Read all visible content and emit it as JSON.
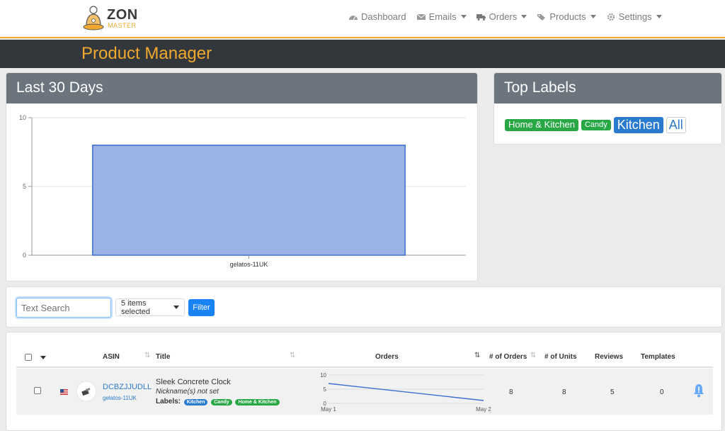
{
  "brand": {
    "name_main": "ZON",
    "name_sub": "MASTER"
  },
  "nav": [
    {
      "label": "Dashboard",
      "icon": "speedometer-icon",
      "has_caret": false
    },
    {
      "label": "Emails",
      "icon": "envelope-icon",
      "has_caret": true
    },
    {
      "label": "Orders",
      "icon": "truck-icon",
      "has_caret": true
    },
    {
      "label": "Products",
      "icon": "tags-icon",
      "has_caret": true
    },
    {
      "label": "Settings",
      "icon": "gear-icon",
      "has_caret": true
    }
  ],
  "page_title": "Product Manager",
  "sales_card": {
    "title": "Last 30 Days",
    "chart_data": {
      "type": "bar",
      "categories": [
        "gelatos-11UK"
      ],
      "values": [
        8
      ],
      "ylim": [
        0,
        10
      ],
      "yticks": [
        0,
        5,
        10
      ],
      "bar_color": "#9ab3e4",
      "bar_border": "#3b6fd0",
      "grid": true
    }
  },
  "labels_card": {
    "title": "Top Labels",
    "tags": [
      {
        "label": "Home & Kitchen",
        "color": "#28a745",
        "size": 13
      },
      {
        "label": "Candy",
        "color": "#28a745",
        "size": 11
      },
      {
        "label": "Kitchen",
        "color": "#2a7bd0",
        "size": 18
      }
    ],
    "all_label": "All"
  },
  "filters": {
    "search_placeholder": "Text Search",
    "items_selected": "5 items selected",
    "filter_button": "Filter"
  },
  "table": {
    "columns": {
      "asin": "ASIN",
      "title": "Title",
      "orders": "Orders",
      "num_orders": "# of Orders",
      "num_units": "# of Units",
      "reviews": "Reviews",
      "templates": "Templates"
    },
    "rows": [
      {
        "asin": "DCBZJJUDLL",
        "store": "gelatos-11UK",
        "title": "Sleek Concrete Clock",
        "nickname": "Nickname(s) not set",
        "labels_prefix": "Labels:",
        "labels": [
          {
            "label": "Kitchen",
            "color": "#2a7bd0"
          },
          {
            "label": "Candy",
            "color": "#28a745"
          },
          {
            "label": "Home & Kitchen",
            "color": "#28a745"
          }
        ],
        "num_orders": "8",
        "num_units": "8",
        "reviews": "5",
        "templates": "0",
        "sparkline": {
          "type": "line",
          "x": [
            "May 1",
            "May 2"
          ],
          "values": [
            7,
            1
          ],
          "ylim": [
            0,
            10
          ],
          "yticks": [
            0,
            5,
            10
          ],
          "color": "#3b6fd0"
        }
      }
    ]
  }
}
